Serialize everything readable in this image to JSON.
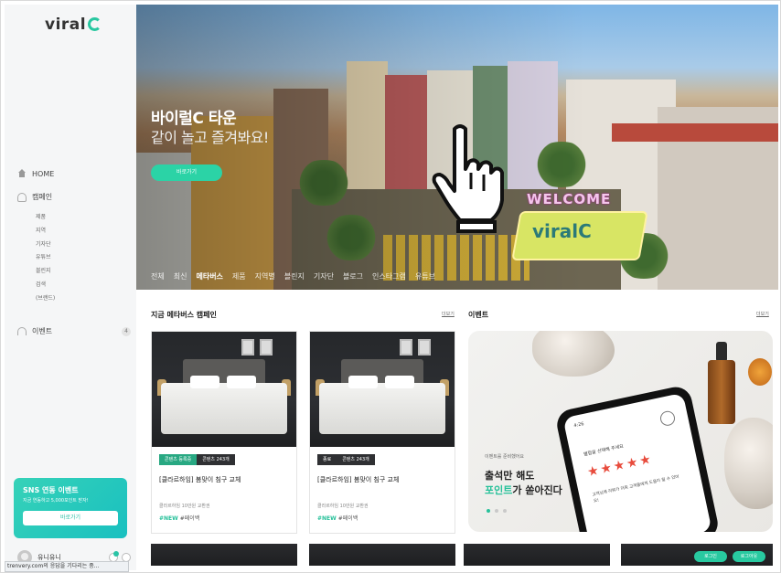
{
  "brand": {
    "logo_text": "viral",
    "accent": "#28c7a0"
  },
  "sidebar": {
    "home_label": "HOME",
    "campaign_label": "캠페인",
    "sub_items": [
      "제품",
      "지역",
      "기자단",
      "유튜브",
      "블린지",
      "검색",
      "(브랜드)"
    ],
    "event_label": "이벤트",
    "event_count": "4",
    "sns_card": {
      "title": "SNS 연동 이벤트",
      "desc": "지금 연동하고 5,000포인트 받자!",
      "button": "바로가기"
    },
    "user_name": "유니유니"
  },
  "status_bar": "trenvery.com의 응답을 기다리는 중...",
  "hero": {
    "title": "바이럴C 타운",
    "subtitle": "같이 놀고 즐겨봐요!",
    "button": "바로가기",
    "welcome": "WELCOME",
    "sign_logo": "viralC",
    "tabs": [
      "전체",
      "최신",
      "메타버스",
      "제품",
      "지역별",
      "블린지",
      "기자단",
      "블로그",
      "인스타그램",
      "유튜브"
    ],
    "active_tab": "메타버스",
    "cursor_icon": "pointing-hand-icon"
  },
  "metaverse_section": {
    "title": "지금 메타버스 캠페인",
    "more": "더보기",
    "cards": [
      {
        "badge1": "콘텐츠 등록중",
        "badge2": "콘텐츠 243개",
        "title": "[클라르하임] 봄맞이 침구 교체",
        "sub": "클라르하임 10만원 교환권",
        "tag_new": "#NEW",
        "tag": "#페이백"
      },
      {
        "badge1": "종료",
        "badge2": "콘텐츠 243개",
        "title": "[클라르하임] 봄맞이 침구 교체",
        "sub": "클라르하임 10만원 교환권",
        "tag_new": "#NEW",
        "tag": "#페이백"
      }
    ]
  },
  "event_section": {
    "title": "이벤트",
    "more": "더보기",
    "small": "이벤트를 준비했어요",
    "line1": "출석만 해도",
    "line2_highlight": "포인트",
    "line2_rest": "가 쏟아진다",
    "phone": {
      "time": "4:26",
      "text": "별점을 선택해 주세요",
      "stars": "★★★★★",
      "text2": "고객님께 리뷰가 더욱 고객들에게 도움이 될 수 있어요!"
    }
  },
  "footer_buttons": [
    "로그인",
    "로그아웃"
  ]
}
